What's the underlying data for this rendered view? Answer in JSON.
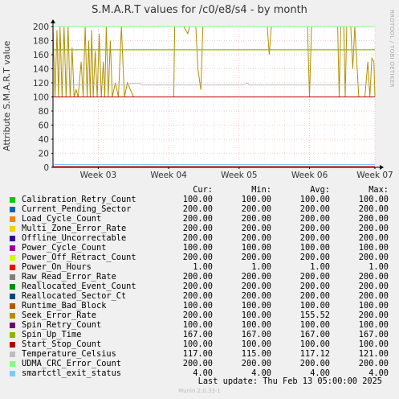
{
  "title": "S.M.A.R.T values for /c0/e8/s4 - by month",
  "side_text": "RRDTOOL / TOBI OETIKER",
  "legend_headers": {
    "cur": "Cur:",
    "min": "Min:",
    "avg": "Avg:",
    "max": "Max:"
  },
  "legend": [
    {
      "name": "Calibration_Retry_Count",
      "color": "#00cc00",
      "cur": "100.00",
      "min": "100.00",
      "avg": "100.00",
      "max": "100.00"
    },
    {
      "name": "Current_Pending_Sector",
      "color": "#0066b3",
      "cur": "200.00",
      "min": "200.00",
      "avg": "200.00",
      "max": "200.00"
    },
    {
      "name": "Load_Cycle_Count",
      "color": "#ff8000",
      "cur": "200.00",
      "min": "200.00",
      "avg": "200.00",
      "max": "200.00"
    },
    {
      "name": "Multi_Zone_Error_Rate",
      "color": "#ffcc00",
      "cur": "200.00",
      "min": "200.00",
      "avg": "200.00",
      "max": "200.00"
    },
    {
      "name": "Offline_Uncorrectable",
      "color": "#330099",
      "cur": "200.00",
      "min": "200.00",
      "avg": "200.00",
      "max": "200.00"
    },
    {
      "name": "Power_Cycle_Count",
      "color": "#990099",
      "cur": "100.00",
      "min": "100.00",
      "avg": "100.00",
      "max": "100.00"
    },
    {
      "name": "Power_Off_Retract_Count",
      "color": "#ccff00",
      "cur": "200.00",
      "min": "200.00",
      "avg": "200.00",
      "max": "200.00"
    },
    {
      "name": "Power_On_Hours",
      "color": "#ff0000",
      "cur": "1.00",
      "min": "1.00",
      "avg": "1.00",
      "max": "1.00"
    },
    {
      "name": "Raw_Read_Error_Rate",
      "color": "#808080",
      "cur": "200.00",
      "min": "200.00",
      "avg": "200.00",
      "max": "200.00"
    },
    {
      "name": "Reallocated_Event_Count",
      "color": "#008f00",
      "cur": "200.00",
      "min": "200.00",
      "avg": "200.00",
      "max": "200.00"
    },
    {
      "name": "Reallocated_Sector_Ct",
      "color": "#00487d",
      "cur": "200.00",
      "min": "200.00",
      "avg": "200.00",
      "max": "200.00"
    },
    {
      "name": "Runtime_Bad_Block",
      "color": "#b35a00",
      "cur": "100.00",
      "min": "100.00",
      "avg": "100.00",
      "max": "100.00"
    },
    {
      "name": "Seek_Error_Rate",
      "color": "#b38f00",
      "cur": "200.00",
      "min": "100.00",
      "avg": "155.52",
      "max": "200.00"
    },
    {
      "name": "Spin_Retry_Count",
      "color": "#6b006b",
      "cur": "100.00",
      "min": "100.00",
      "avg": "100.00",
      "max": "100.00"
    },
    {
      "name": "Spin_Up_Time",
      "color": "#8fb300",
      "cur": "167.00",
      "min": "167.00",
      "avg": "167.00",
      "max": "167.00"
    },
    {
      "name": "Start_Stop_Count",
      "color": "#b30000",
      "cur": "100.00",
      "min": "100.00",
      "avg": "100.00",
      "max": "100.00"
    },
    {
      "name": "Temperature_Celsius",
      "color": "#bebebe",
      "cur": "117.00",
      "min": "115.00",
      "avg": "117.12",
      "max": "121.00"
    },
    {
      "name": "UDMA_CRC_Error_Count",
      "color": "#80ff80",
      "cur": "200.00",
      "min": "200.00",
      "avg": "200.00",
      "max": "200.00"
    },
    {
      "name": "smartctl_exit_status",
      "color": "#80c9ff",
      "cur": "4.00",
      "min": "4.00",
      "avg": "4.00",
      "max": "4.00"
    }
  ],
  "last_update": "Last update:  Thu Feb 13 05:00:00 2025",
  "footer": "Munin 2.0.33-1",
  "chart_data": {
    "type": "line",
    "title": "S.M.A.R.T values for /c0/e8/s4 - by month",
    "ylabel": "Attribute S.M.A.R.T value",
    "xlabel": "",
    "ylim": [
      0,
      200
    ],
    "yticks": [
      0,
      20,
      40,
      60,
      80,
      100,
      120,
      140,
      160,
      180,
      200
    ],
    "xlim": [
      0,
      32
    ],
    "xticks": [
      {
        "label": "Week 03",
        "x": 4.5
      },
      {
        "label": "Week 04",
        "x": 11.5
      },
      {
        "label": "Week 05",
        "x": 18.5
      },
      {
        "label": "Week 06",
        "x": 25.5
      },
      {
        "label": "Week 07",
        "x": 32
      }
    ],
    "grid": true,
    "series": [
      {
        "name": "Calibration_Retry_Count",
        "color": "#00cc00",
        "constant": 100
      },
      {
        "name": "Current_Pending_Sector",
        "color": "#0066b3",
        "constant": 200
      },
      {
        "name": "Load_Cycle_Count",
        "color": "#ff8000",
        "constant": 200
      },
      {
        "name": "Multi_Zone_Error_Rate",
        "color": "#ffcc00",
        "constant": 200
      },
      {
        "name": "Offline_Uncorrectable",
        "color": "#330099",
        "constant": 200
      },
      {
        "name": "Power_Cycle_Count",
        "color": "#990099",
        "constant": 100
      },
      {
        "name": "Power_Off_Retract_Count",
        "color": "#ccff00",
        "constant": 200
      },
      {
        "name": "Power_On_Hours",
        "color": "#ff0000",
        "constant": 1
      },
      {
        "name": "Raw_Read_Error_Rate",
        "color": "#808080",
        "constant": 200
      },
      {
        "name": "Reallocated_Event_Count",
        "color": "#008f00",
        "constant": 200
      },
      {
        "name": "Reallocated_Sector_Ct",
        "color": "#00487d",
        "constant": 200
      },
      {
        "name": "Runtime_Bad_Block",
        "color": "#b35a00",
        "constant": 100
      },
      {
        "name": "Seek_Error_Rate",
        "color": "#b38f00",
        "points": [
          [
            0,
            200
          ],
          [
            0.2,
            100
          ],
          [
            0.4,
            195
          ],
          [
            0.55,
            100
          ],
          [
            0.7,
            200
          ],
          [
            0.9,
            100
          ],
          [
            1.1,
            200
          ],
          [
            1.3,
            100
          ],
          [
            1.5,
            200
          ],
          [
            1.7,
            100
          ],
          [
            1.9,
            170
          ],
          [
            2.1,
            100
          ],
          [
            2.3,
            110
          ],
          [
            2.5,
            100
          ],
          [
            2.8,
            150
          ],
          [
            3.0,
            100
          ],
          [
            3.2,
            200
          ],
          [
            3.4,
            100
          ],
          [
            3.55,
            180
          ],
          [
            3.7,
            100
          ],
          [
            3.85,
            195
          ],
          [
            4.0,
            100
          ],
          [
            4.2,
            165
          ],
          [
            4.4,
            100
          ],
          [
            4.6,
            190
          ],
          [
            4.8,
            100
          ],
          [
            5.0,
            150
          ],
          [
            5.15,
            100
          ],
          [
            5.3,
            200
          ],
          [
            5.5,
            100
          ],
          [
            5.7,
            180
          ],
          [
            5.9,
            100
          ],
          [
            6.2,
            120
          ],
          [
            6.5,
            100
          ],
          [
            6.8,
            200
          ],
          [
            7.1,
            100
          ],
          [
            7.4,
            120
          ],
          [
            8.0,
            100
          ],
          [
            12.0,
            100
          ],
          [
            12.1,
            200
          ],
          [
            13.0,
            200
          ],
          [
            13.4,
            190
          ],
          [
            13.6,
            200
          ],
          [
            14.2,
            200
          ],
          [
            14.4,
            140
          ],
          [
            14.7,
            110
          ],
          [
            14.9,
            200
          ],
          [
            21.0,
            200
          ],
          [
            21.3,
            200
          ],
          [
            21.5,
            160
          ],
          [
            21.7,
            200
          ],
          [
            25.0,
            200
          ],
          [
            25.3,
            200
          ],
          [
            25.5,
            100
          ],
          [
            25.7,
            200
          ],
          [
            28.3,
            200
          ],
          [
            28.45,
            100
          ],
          [
            28.6,
            200
          ],
          [
            28.9,
            200
          ],
          [
            29.05,
            100
          ],
          [
            29.2,
            200
          ],
          [
            29.6,
            200
          ],
          [
            29.8,
            140
          ],
          [
            30.0,
            200
          ],
          [
            30.4,
            100
          ],
          [
            31.0,
            100
          ],
          [
            31.3,
            150
          ],
          [
            31.5,
            100
          ],
          [
            31.7,
            155
          ],
          [
            31.9,
            150
          ],
          [
            32,
            100
          ]
        ]
      },
      {
        "name": "Spin_Retry_Count",
        "color": "#6b006b",
        "constant": 100
      },
      {
        "name": "Spin_Up_Time",
        "color": "#8fb300",
        "constant": 167
      },
      {
        "name": "Start_Stop_Count",
        "color": "#b30000",
        "constant": 100
      },
      {
        "name": "Temperature_Celsius",
        "color": "#bebebe",
        "points": [
          [
            0,
            117
          ],
          [
            7.4,
            117
          ],
          [
            7.7,
            119
          ],
          [
            8.6,
            119
          ],
          [
            8.9,
            117
          ],
          [
            19.0,
            117
          ],
          [
            19.3,
            120
          ],
          [
            19.5,
            117
          ],
          [
            32,
            117
          ]
        ]
      },
      {
        "name": "UDMA_CRC_Error_Count",
        "color": "#80ff80",
        "constant": 200
      },
      {
        "name": "smartctl_exit_status",
        "color": "#80c9ff",
        "constant": 4
      }
    ]
  }
}
